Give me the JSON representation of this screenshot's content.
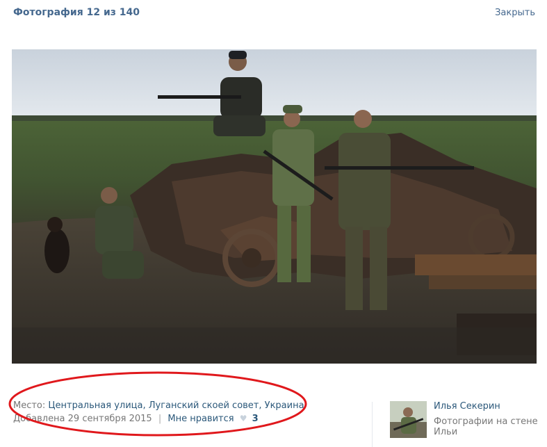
{
  "header": {
    "title": "Фотография 12 из 140",
    "close_label": "Закрыть"
  },
  "photo": {
    "icon": "photo-military-scene"
  },
  "info": {
    "place_label": "Место:",
    "place_value": "Центральная улица, Луганский скоей совет, Украина",
    "added": "Добавлена 29 сентября 2015",
    "separator": "|",
    "like_label": "Мне нравится",
    "like_count": "3"
  },
  "author": {
    "name": "Илья Секерин",
    "album": "Фотографии на стене Ильи"
  },
  "colors": {
    "link": "#2b587a",
    "header_link": "#45688e",
    "muted": "#777777",
    "annotation": "#e0181c"
  }
}
